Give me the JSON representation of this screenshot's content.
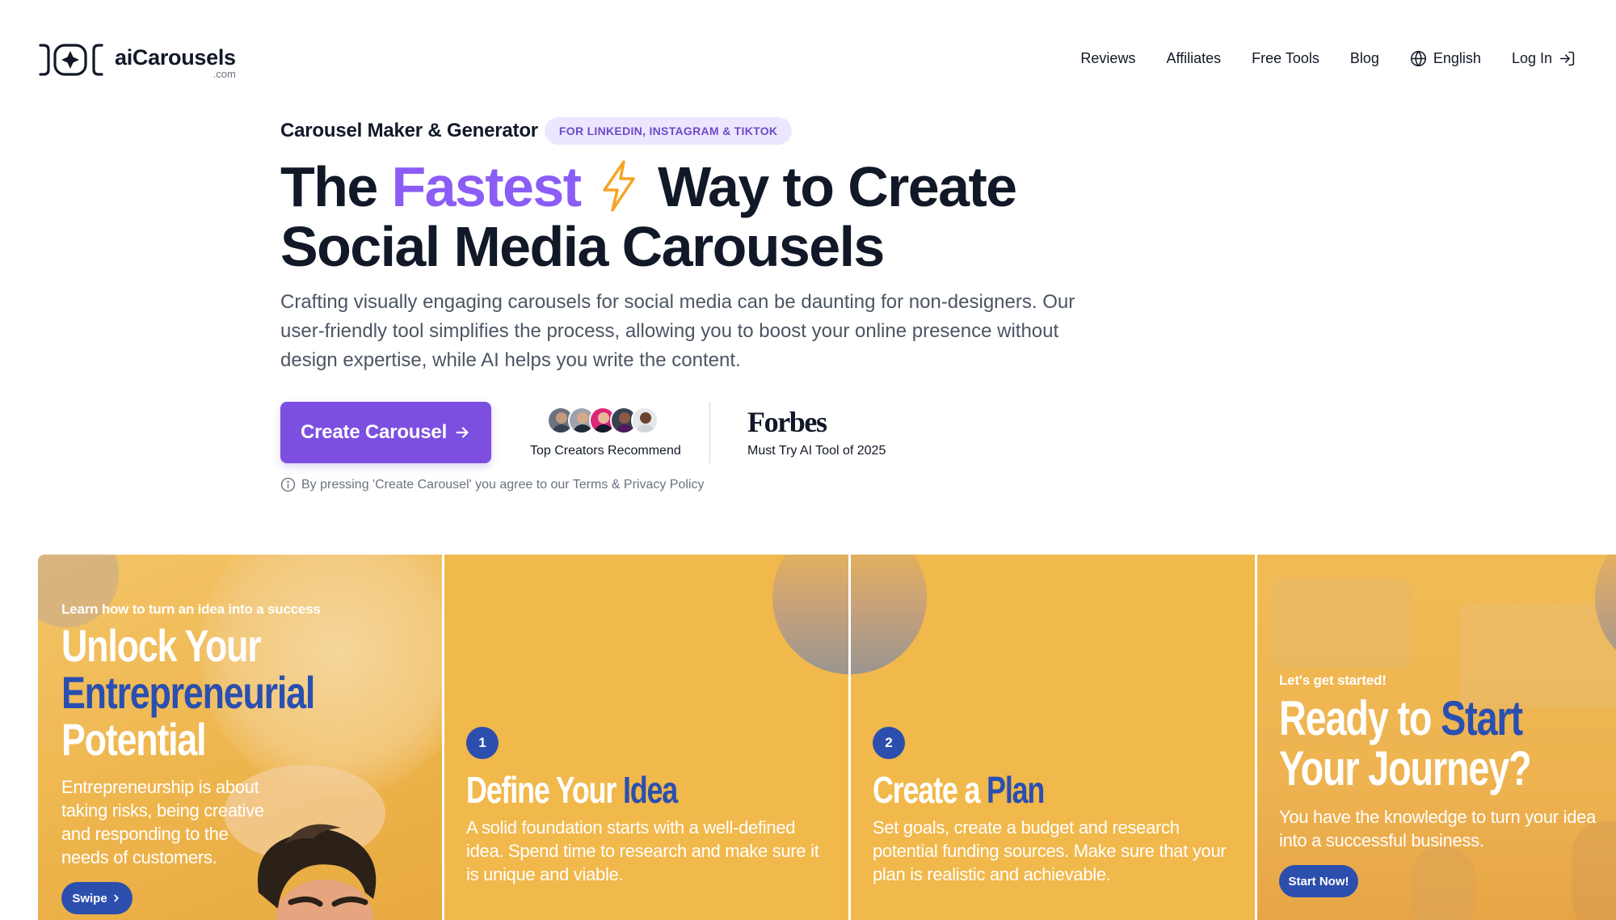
{
  "header": {
    "logo_name": "aiCarousels",
    "logo_sub": ".com",
    "nav": [
      {
        "label": "Reviews"
      },
      {
        "label": "Affiliates"
      },
      {
        "label": "Free Tools"
      },
      {
        "label": "Blog"
      },
      {
        "label": "English",
        "icon": "globe-icon"
      },
      {
        "label": "Log In",
        "icon": "login-arrow-icon"
      }
    ]
  },
  "hero": {
    "eyebrow_title": "Carousel Maker & Generator",
    "eyebrow_badge": "FOR LINKEDIN, INSTAGRAM & TIKTOK",
    "headline_part1": "The ",
    "headline_accent": "Fastest",
    "headline_part2": " Way to Create",
    "headline_line2": "Social Media Carousels",
    "description": "Crafting visually engaging carousels for social media can be daunting for non-designers. Our user-friendly tool simplifies the process, allowing you to boost your online presence without design expertise, while AI helps you write the content.",
    "cta_label": "Create Carousel",
    "creators_label": "Top Creators Recommend",
    "forbes_logo": "Forbes",
    "forbes_label": "Must Try AI Tool of 2025",
    "terms": "By pressing 'Create Carousel' you agree to our Terms & Privacy Policy"
  },
  "colors": {
    "accent_purple": "#8b5cf6",
    "cta_purple": "#7c4fe0",
    "slide_yellow": "#f1b84b",
    "slide_blue": "#2a4fb0"
  },
  "slides": [
    {
      "kicker": "Learn how to turn an idea into a success",
      "title_line1": "Unlock Your",
      "title_line2": "Entrepreneurial",
      "title_line3": "Potential",
      "body": "Entrepreneurship is about taking risks, being creative and responding to the needs of customers.",
      "button": "Swipe"
    },
    {
      "number": "1",
      "title_plain": "Define Your ",
      "title_blue": "Idea",
      "body": "A solid foundation starts with a well-defined idea. Spend time to research and make sure it is unique and viable."
    },
    {
      "number": "2",
      "title_plain": "Create a ",
      "title_blue": "Plan",
      "body": "Set goals, create a budget and research potential funding sources. Make sure that your plan is realistic and achievable."
    },
    {
      "kicker": "Let's get started!",
      "title_plain1": "Ready to ",
      "title_blue": "Start",
      "title_line2": "Your Journey?",
      "body": "You have the knowledge to turn your idea into a successful business.",
      "button": "Start Now!"
    }
  ]
}
